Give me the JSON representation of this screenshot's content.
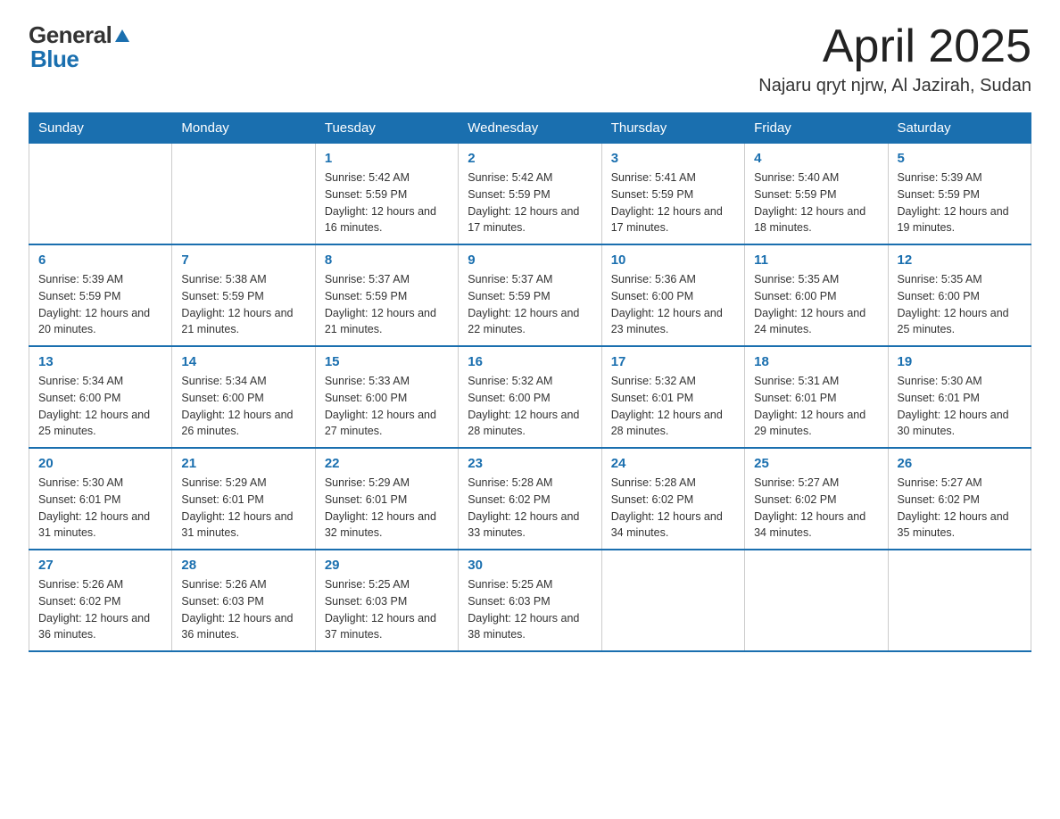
{
  "header": {
    "logo_general": "General",
    "logo_blue": "Blue",
    "title": "April 2025",
    "subtitle": "Najaru qryt njrw, Al Jazirah, Sudan"
  },
  "weekdays": [
    "Sunday",
    "Monday",
    "Tuesday",
    "Wednesday",
    "Thursday",
    "Friday",
    "Saturday"
  ],
  "weeks": [
    [
      {
        "day": "",
        "sunrise": "",
        "sunset": "",
        "daylight": ""
      },
      {
        "day": "",
        "sunrise": "",
        "sunset": "",
        "daylight": ""
      },
      {
        "day": "1",
        "sunrise": "Sunrise: 5:42 AM",
        "sunset": "Sunset: 5:59 PM",
        "daylight": "Daylight: 12 hours and 16 minutes."
      },
      {
        "day": "2",
        "sunrise": "Sunrise: 5:42 AM",
        "sunset": "Sunset: 5:59 PM",
        "daylight": "Daylight: 12 hours and 17 minutes."
      },
      {
        "day": "3",
        "sunrise": "Sunrise: 5:41 AM",
        "sunset": "Sunset: 5:59 PM",
        "daylight": "Daylight: 12 hours and 17 minutes."
      },
      {
        "day": "4",
        "sunrise": "Sunrise: 5:40 AM",
        "sunset": "Sunset: 5:59 PM",
        "daylight": "Daylight: 12 hours and 18 minutes."
      },
      {
        "day": "5",
        "sunrise": "Sunrise: 5:39 AM",
        "sunset": "Sunset: 5:59 PM",
        "daylight": "Daylight: 12 hours and 19 minutes."
      }
    ],
    [
      {
        "day": "6",
        "sunrise": "Sunrise: 5:39 AM",
        "sunset": "Sunset: 5:59 PM",
        "daylight": "Daylight: 12 hours and 20 minutes."
      },
      {
        "day": "7",
        "sunrise": "Sunrise: 5:38 AM",
        "sunset": "Sunset: 5:59 PM",
        "daylight": "Daylight: 12 hours and 21 minutes."
      },
      {
        "day": "8",
        "sunrise": "Sunrise: 5:37 AM",
        "sunset": "Sunset: 5:59 PM",
        "daylight": "Daylight: 12 hours and 21 minutes."
      },
      {
        "day": "9",
        "sunrise": "Sunrise: 5:37 AM",
        "sunset": "Sunset: 5:59 PM",
        "daylight": "Daylight: 12 hours and 22 minutes."
      },
      {
        "day": "10",
        "sunrise": "Sunrise: 5:36 AM",
        "sunset": "Sunset: 6:00 PM",
        "daylight": "Daylight: 12 hours and 23 minutes."
      },
      {
        "day": "11",
        "sunrise": "Sunrise: 5:35 AM",
        "sunset": "Sunset: 6:00 PM",
        "daylight": "Daylight: 12 hours and 24 minutes."
      },
      {
        "day": "12",
        "sunrise": "Sunrise: 5:35 AM",
        "sunset": "Sunset: 6:00 PM",
        "daylight": "Daylight: 12 hours and 25 minutes."
      }
    ],
    [
      {
        "day": "13",
        "sunrise": "Sunrise: 5:34 AM",
        "sunset": "Sunset: 6:00 PM",
        "daylight": "Daylight: 12 hours and 25 minutes."
      },
      {
        "day": "14",
        "sunrise": "Sunrise: 5:34 AM",
        "sunset": "Sunset: 6:00 PM",
        "daylight": "Daylight: 12 hours and 26 minutes."
      },
      {
        "day": "15",
        "sunrise": "Sunrise: 5:33 AM",
        "sunset": "Sunset: 6:00 PM",
        "daylight": "Daylight: 12 hours and 27 minutes."
      },
      {
        "day": "16",
        "sunrise": "Sunrise: 5:32 AM",
        "sunset": "Sunset: 6:00 PM",
        "daylight": "Daylight: 12 hours and 28 minutes."
      },
      {
        "day": "17",
        "sunrise": "Sunrise: 5:32 AM",
        "sunset": "Sunset: 6:01 PM",
        "daylight": "Daylight: 12 hours and 28 minutes."
      },
      {
        "day": "18",
        "sunrise": "Sunrise: 5:31 AM",
        "sunset": "Sunset: 6:01 PM",
        "daylight": "Daylight: 12 hours and 29 minutes."
      },
      {
        "day": "19",
        "sunrise": "Sunrise: 5:30 AM",
        "sunset": "Sunset: 6:01 PM",
        "daylight": "Daylight: 12 hours and 30 minutes."
      }
    ],
    [
      {
        "day": "20",
        "sunrise": "Sunrise: 5:30 AM",
        "sunset": "Sunset: 6:01 PM",
        "daylight": "Daylight: 12 hours and 31 minutes."
      },
      {
        "day": "21",
        "sunrise": "Sunrise: 5:29 AM",
        "sunset": "Sunset: 6:01 PM",
        "daylight": "Daylight: 12 hours and 31 minutes."
      },
      {
        "day": "22",
        "sunrise": "Sunrise: 5:29 AM",
        "sunset": "Sunset: 6:01 PM",
        "daylight": "Daylight: 12 hours and 32 minutes."
      },
      {
        "day": "23",
        "sunrise": "Sunrise: 5:28 AM",
        "sunset": "Sunset: 6:02 PM",
        "daylight": "Daylight: 12 hours and 33 minutes."
      },
      {
        "day": "24",
        "sunrise": "Sunrise: 5:28 AM",
        "sunset": "Sunset: 6:02 PM",
        "daylight": "Daylight: 12 hours and 34 minutes."
      },
      {
        "day": "25",
        "sunrise": "Sunrise: 5:27 AM",
        "sunset": "Sunset: 6:02 PM",
        "daylight": "Daylight: 12 hours and 34 minutes."
      },
      {
        "day": "26",
        "sunrise": "Sunrise: 5:27 AM",
        "sunset": "Sunset: 6:02 PM",
        "daylight": "Daylight: 12 hours and 35 minutes."
      }
    ],
    [
      {
        "day": "27",
        "sunrise": "Sunrise: 5:26 AM",
        "sunset": "Sunset: 6:02 PM",
        "daylight": "Daylight: 12 hours and 36 minutes."
      },
      {
        "day": "28",
        "sunrise": "Sunrise: 5:26 AM",
        "sunset": "Sunset: 6:03 PM",
        "daylight": "Daylight: 12 hours and 36 minutes."
      },
      {
        "day": "29",
        "sunrise": "Sunrise: 5:25 AM",
        "sunset": "Sunset: 6:03 PM",
        "daylight": "Daylight: 12 hours and 37 minutes."
      },
      {
        "day": "30",
        "sunrise": "Sunrise: 5:25 AM",
        "sunset": "Sunset: 6:03 PM",
        "daylight": "Daylight: 12 hours and 38 minutes."
      },
      {
        "day": "",
        "sunrise": "",
        "sunset": "",
        "daylight": ""
      },
      {
        "day": "",
        "sunrise": "",
        "sunset": "",
        "daylight": ""
      },
      {
        "day": "",
        "sunrise": "",
        "sunset": "",
        "daylight": ""
      }
    ]
  ]
}
